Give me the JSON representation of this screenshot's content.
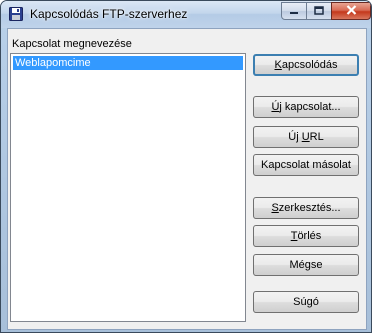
{
  "window": {
    "title": "Kapcsolódás FTP-szerverhez",
    "icon": "floppy-disk-icon"
  },
  "caption_buttons": {
    "minimize_icon": "minimize-icon",
    "maximize_icon": "maximize-icon",
    "close_icon": "close-icon"
  },
  "connections": {
    "label": "Kapcsolat megnevezése",
    "items": [
      {
        "label": "Weblapomcime",
        "selected": true
      }
    ]
  },
  "buttons": {
    "connect": {
      "label": "Kapcsolódás",
      "accel": "K",
      "rest": "apcsolódás"
    },
    "new_connection": {
      "label": "Új kapcsolat...",
      "accel": "Ú",
      "rest": "j kapcsolat..."
    },
    "new_url": {
      "label": "Új URL",
      "pre": "Új ",
      "accel": "U",
      "rest": "RL"
    },
    "copy_connection": {
      "label": "Kapcsolat másolat"
    },
    "edit": {
      "label": "Szerkesztés...",
      "accel": "S",
      "rest": "zerkesztés..."
    },
    "delete": {
      "label": "Törlés",
      "accel": "T",
      "rest": "örlés"
    },
    "cancel": {
      "label": "Mégse"
    },
    "help": {
      "label": "Súgó"
    }
  }
}
